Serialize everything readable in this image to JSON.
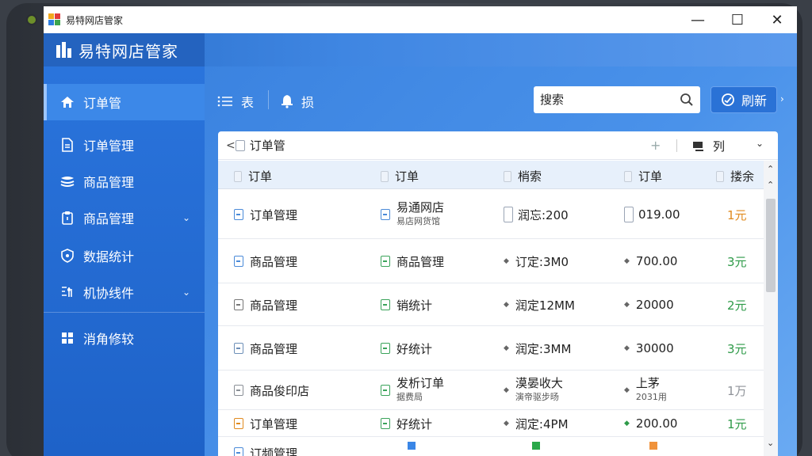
{
  "window": {
    "title": "易特网店管家",
    "minimize": "—",
    "maximize": "☐",
    "close": "✕"
  },
  "brand": {
    "name": "易特网店管家"
  },
  "sidebar": {
    "items": [
      {
        "label": "订单管",
        "icon": "home-icon",
        "active": true
      },
      {
        "label": "订单管理",
        "icon": "document-icon"
      },
      {
        "label": "商品管理",
        "icon": "layers-icon"
      },
      {
        "label": "商品管理",
        "icon": "clipboard-icon",
        "expandable": true
      },
      {
        "label": "数据统计",
        "icon": "shield-icon"
      },
      {
        "label": "机协线件",
        "icon": "settings-grid-icon",
        "expandable": true
      },
      {
        "label": "消角修较",
        "icon": "grid-icon"
      }
    ]
  },
  "toolbar": {
    "list_label": "表",
    "notify_label": "损",
    "search_placeholder": "搜索",
    "refresh_label": "刷新"
  },
  "panel": {
    "back": "<",
    "title": "订单管",
    "plus": "+",
    "columns_label": "列",
    "chevron": "⌄"
  },
  "table": {
    "headers": [
      "订单",
      "订单",
      "梢索",
      "订单",
      "搂余"
    ],
    "rows": [
      {
        "c1": "订单管理",
        "c1_color": "#4a8ad8",
        "c2": "易通网店",
        "c2_sub": "易店网货馆",
        "c2_color": "#4a8ad8",
        "c3": "润忘:200",
        "c3_mark": "box",
        "c4": "019.00",
        "c4_mark": "box",
        "c5": "1元",
        "c5_color": "#e08a1e"
      },
      {
        "c1": "商品管理",
        "c1_color": "#4a8ad8",
        "c2": "商品管理",
        "c2_color": "#3aa35a",
        "c3": "订定:3M0",
        "c3_mark": "dot",
        "c4": "700.00",
        "c4_mark": "dot",
        "c5": "3元",
        "c5_color": "#2e9a48"
      },
      {
        "c1": "商品管理",
        "c1_color": "#777",
        "c2": "销统计",
        "c2_color": "#3aa35a",
        "c3": "润定12MM",
        "c3_mark": "dot",
        "c4": "20000",
        "c4_mark": "dot",
        "c5": "2元",
        "c5_color": "#2e9a48"
      },
      {
        "c1": "商品管理",
        "c1_color": "#6d8fb8",
        "c2": "好统计",
        "c2_color": "#3aa35a",
        "c3": "润定:3MM",
        "c3_mark": "dot",
        "c4": "30000",
        "c4_mark": "dot",
        "c5": "3元",
        "c5_color": "#2e9a48"
      },
      {
        "c1": "商品俊印店",
        "c1_color": "#8a8f96",
        "c2": "发析订单",
        "c2_sub": "据费局",
        "c2_color": "#3aa35a",
        "c3": "漠晏收大",
        "c3_sub": "演帝驱步旸",
        "c3_mark": "dot",
        "c4": "上茅",
        "c4_sub": "2031用",
        "c4_mark": "dot",
        "c5": "1万",
        "c5_color": "#8f9399"
      },
      {
        "c1": "订单管理",
        "c1_color": "#e08a1e",
        "c2": "好统计",
        "c2_color": "#3aa35a",
        "c3": "润定:4PM",
        "c3_mark": "dot",
        "c4": "200.00",
        "c4_mark": "dot-green",
        "c5": "1元",
        "c5_color": "#2e9a48"
      },
      {
        "c1": "订频管理",
        "c1_color": "#4a8ad8",
        "c2": "",
        "c2_color": "#3a86e6",
        "c3": "",
        "c3_color": "#2aa84a",
        "c4": "",
        "c4_color": "#f0923a",
        "c5": "",
        "c5_color": "#2e9a48"
      }
    ]
  },
  "scroll": {
    "up": "⌃",
    "down": "⌄"
  },
  "colors": {
    "accent": "#1f6fd6",
    "sidebar": "#2463bf",
    "active_item": "#3c88e8",
    "header_row": "#e7f0fb"
  }
}
